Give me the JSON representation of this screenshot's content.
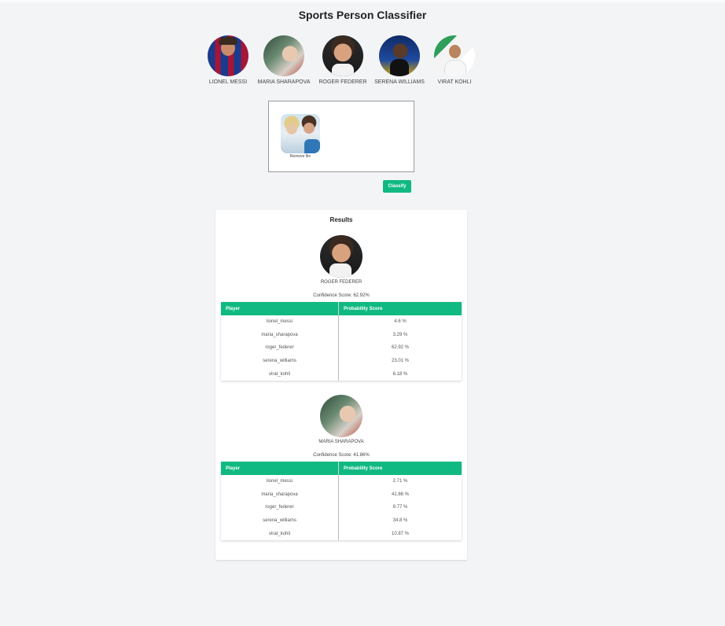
{
  "app": {
    "title": "Sports Person Classifier"
  },
  "players": [
    {
      "name": "LIONEL MESSI",
      "avatar": "messi-avatar"
    },
    {
      "name": "MARIA SHARAPOVA",
      "avatar": "sharapova-avatar"
    },
    {
      "name": "ROGER FEDERER",
      "avatar": "federer-avatar"
    },
    {
      "name": "SERENA WILLIAMS",
      "avatar": "serena-avatar"
    },
    {
      "name": "VIRAT KOHLI",
      "avatar": "kohli-avatar"
    }
  ],
  "upload": {
    "remove_label": "Remove file"
  },
  "classify_label": "Classify",
  "results": {
    "title": "Results",
    "columns": [
      "Player",
      "Probability Score"
    ],
    "items": [
      {
        "name": "ROGER FEDERER",
        "confidence": "Confidence Score: 62.92%",
        "rows": [
          [
            "lionel_messi",
            "4.6 %"
          ],
          [
            "maria_sharapova",
            "3.29 %"
          ],
          [
            "roger_federer",
            "62.92 %"
          ],
          [
            "serena_williams",
            "23.01 %"
          ],
          [
            "virat_kohli",
            "6.18 %"
          ]
        ]
      },
      {
        "name": "MARIA SHARAPOVA",
        "confidence": "Confidence Score: 41.86%",
        "rows": [
          [
            "lionel_messi",
            "2.71 %"
          ],
          [
            "maria_sharapova",
            "41.86 %"
          ],
          [
            "roger_federer",
            "9.77 %"
          ],
          [
            "serena_williams",
            "34.8 %"
          ],
          [
            "virat_kohli",
            "10.87 %"
          ]
        ]
      }
    ]
  },
  "colors": {
    "accent": "#10b981",
    "background": "#f3f4f6"
  }
}
